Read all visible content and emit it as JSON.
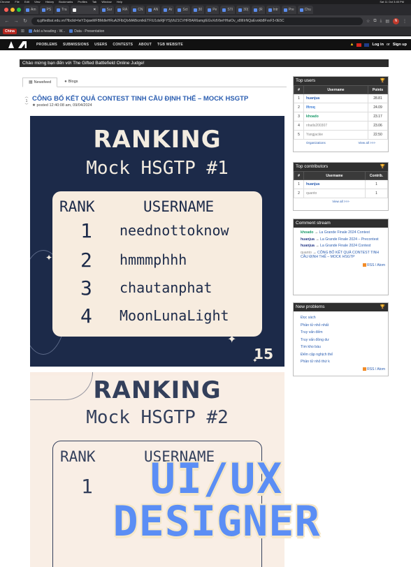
{
  "browser": {
    "menubar": [
      "Chrome",
      "File",
      "Edit",
      "View",
      "History",
      "Bookmarks",
      "Profiles",
      "Tab",
      "Window",
      "Help"
    ],
    "clock": "Sat 11 Oct 3:45 PM",
    "tabs": [
      "Am",
      "PS",
      "Tra",
      "",
      "Sur",
      "RA",
      "CN",
      "AN",
      "Ar",
      "Sct",
      "30",
      "Pe",
      "STI",
      "30(",
      "(R",
      "Intr",
      "Pre",
      "Chu"
    ],
    "url": "q.giftedbat.edu.vn/?lbclid=IwY2xjawMFBMdleHRuA2FlbQIxMABicmlkETFIU1dsRjFYSjVb21CVHFBAR6amgIEGvXdVbeHHaiOv_x8lIIIrNQaEvokb8FvsF3-0E5C",
    "bookmarks": {
      "china": "China",
      "item1": "Add a heading - W...",
      "item2": "Data - Presentation"
    }
  },
  "site": {
    "nav": [
      "PROBLEMS",
      "SUBMISSIONS",
      "USERS",
      "CONTESTS",
      "ABOUT",
      "TGB WEBSITE"
    ],
    "login": "Log in",
    "or": "or",
    "signup": "Sign up",
    "welcome": "Chào mừng bạn đến với The Gifted Battlefield Online Judge!"
  },
  "content": {
    "tabs": [
      "Newsfeed",
      "Blogs"
    ],
    "post": {
      "vote_up": "︿",
      "vote_count": "1",
      "vote_down": "﹀",
      "title": "CÔNG BỐ KẾT QUẢ CONTEST TINH CẦU ĐỊNH THẾ – MOCK HSGTP",
      "meta": "★ posted 12:40:08 am, 09/04/2024"
    },
    "ranking1": {
      "title": "RANKING",
      "subtitle": "Mock HSGTP #1",
      "col_rank": "RANK",
      "col_user": "USERNAME",
      "rows": [
        {
          "rank": "1",
          "name": "neednottoknow"
        },
        {
          "rank": "2",
          "name": "hmmmphhh"
        },
        {
          "rank": "3",
          "name": "chautanphat"
        },
        {
          "rank": "4",
          "name": "MoonLunaLight"
        }
      ],
      "badge": "15"
    },
    "ranking2": {
      "title": "RANKING",
      "subtitle": "Mock HSGTP #2",
      "col_rank": "RANK",
      "col_user": "USERNAME",
      "first_rank": "1"
    }
  },
  "sidebar": {
    "top_users": {
      "title": "Top users",
      "headers": [
        "#",
        "Username",
        "Points"
      ],
      "rows": [
        {
          "rank": "1",
          "name": "huanjua",
          "points": "28.81"
        },
        {
          "rank": "2",
          "name": "lftroq",
          "points": "24.09"
        },
        {
          "rank": "3",
          "name": "khoado",
          "points": "23.17"
        },
        {
          "rank": "4",
          "name": "nhatls200307",
          "points": "23.06"
        },
        {
          "rank": "5",
          "name": "Yangjackie",
          "points": "22.50"
        }
      ],
      "footer_left": "Organizations",
      "footer_right": "View all >>>"
    },
    "top_contributors": {
      "title": "Top contributors",
      "headers": [
        "#",
        "Username",
        "Contrib."
      ],
      "rows": [
        {
          "rank": "1",
          "name": "huanjua",
          "contrib": "1"
        },
        {
          "rank": "2",
          "name": "quanto",
          "contrib": "1"
        }
      ],
      "footer": "View all >>>"
    },
    "comment_stream": {
      "title": "Comment stream",
      "items": [
        {
          "user": "khoado",
          "arrow": "→",
          "target": "La Grande Finale 2024 Contest"
        },
        {
          "user": "huanjua",
          "arrow": "→",
          "target": "La Grande Finale 2024 – Precontest"
        },
        {
          "user": "huanjua",
          "arrow": "→",
          "target": "La Grande Finale 2024 Contest"
        },
        {
          "user": "quanto",
          "arrow": "→",
          "target": "CÔNG BỐ KẾT QUẢ CONTEST TINH CẦU ĐỊNH THẾ – MOCK HSGTP"
        }
      ],
      "rss": "RSS",
      "atom": "Atom"
    },
    "new_problems": {
      "title": "New problems",
      "items": [
        "Đọc sách",
        "Phần tử nhỏ nhất",
        "Truy vấn đếm",
        "Truy vấn đồng dư",
        "Tìm kho báu",
        "Đếm cặp nghịch thế",
        "Phần tử nhỏ thứ k"
      ],
      "rss": "RSS",
      "atom": "Atom"
    }
  },
  "overlay": {
    "line1": "UI/UX",
    "line2": "DESIGNER"
  },
  "colors": {
    "accent_blue": "#5b8ef5",
    "overlay_outline": "#f5e7c8",
    "navy": "#1c2a49",
    "cream": "#f7ecdf",
    "link": "#2a5db0"
  }
}
